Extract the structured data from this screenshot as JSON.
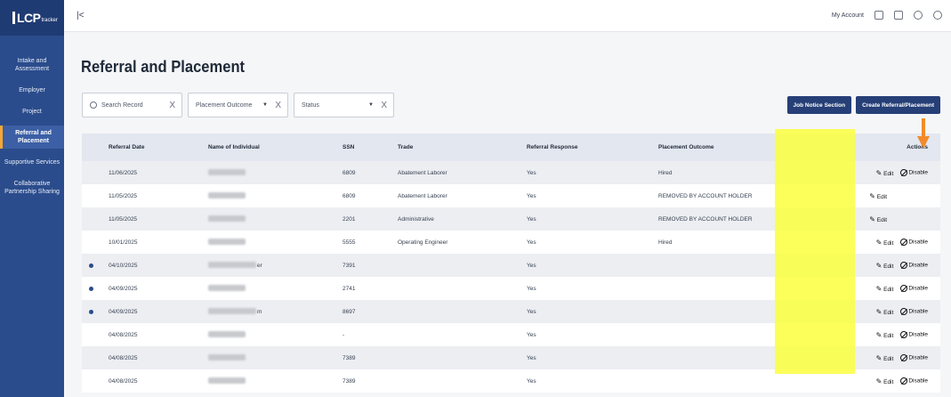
{
  "app": {
    "logo_text": "LCP",
    "logo_sub": "tracker",
    "collapse": "|<",
    "my_account": "My Account"
  },
  "sidebar": {
    "items": [
      {
        "label": "Intake and Assessment",
        "active": false
      },
      {
        "label": "Employer",
        "active": false
      },
      {
        "label": "Project",
        "active": false
      },
      {
        "label": "Referral and Placement",
        "active": true
      },
      {
        "label": "Supportive Services",
        "active": false
      },
      {
        "label": "Collaborative Partnership Sharing",
        "active": false
      }
    ]
  },
  "page": {
    "title": "Referral and Placement"
  },
  "filters": {
    "search_placeholder": "Search Record",
    "outcome_label": "Placement Outcome",
    "status_label": "Status",
    "clear": "X",
    "caret": "▼"
  },
  "buttons": {
    "job_notice": "Job Notice Section",
    "create": "Create Referral/Placement"
  },
  "table": {
    "columns": [
      "Referral Date",
      "Name of Individual",
      "SSN",
      "Trade",
      "Referral Response",
      "Placement Outcome",
      "Actions"
    ],
    "rows": [
      {
        "date": "11/06/2025",
        "ssn": "6809",
        "trade": "Abatement Laborer",
        "response": "Yes",
        "outcome": "Hired",
        "dot": false,
        "disable": true,
        "suffix": ""
      },
      {
        "date": "11/05/2025",
        "ssn": "6809",
        "trade": "Abatement Laborer",
        "response": "Yes",
        "outcome": "REMOVED BY ACCOUNT HOLDER",
        "dot": false,
        "disable": false,
        "suffix": ""
      },
      {
        "date": "11/05/2025",
        "ssn": "2201",
        "trade": "Administrative",
        "response": "Yes",
        "outcome": "REMOVED BY ACCOUNT HOLDER",
        "dot": false,
        "disable": false,
        "suffix": ""
      },
      {
        "date": "10/01/2025",
        "ssn": "5555",
        "trade": "Operating Engineer",
        "response": "Yes",
        "outcome": "Hired",
        "dot": false,
        "disable": true,
        "suffix": ""
      },
      {
        "date": "04/10/2025",
        "ssn": "7391",
        "trade": "",
        "response": "Yes",
        "outcome": "",
        "dot": true,
        "disable": true,
        "suffix": "er"
      },
      {
        "date": "04/09/2025",
        "ssn": "2741",
        "trade": "",
        "response": "Yes",
        "outcome": "",
        "dot": true,
        "disable": true,
        "suffix": ""
      },
      {
        "date": "04/09/2025",
        "ssn": "8697",
        "trade": "",
        "response": "Yes",
        "outcome": "",
        "dot": true,
        "disable": true,
        "suffix": "m"
      },
      {
        "date": "04/08/2025",
        "ssn": "-",
        "trade": "",
        "response": "Yes",
        "outcome": "",
        "dot": false,
        "disable": true,
        "suffix": ""
      },
      {
        "date": "04/08/2025",
        "ssn": "7389",
        "trade": "",
        "response": "Yes",
        "outcome": "",
        "dot": false,
        "disable": true,
        "suffix": ""
      },
      {
        "date": "04/08/2025",
        "ssn": "7389",
        "trade": "",
        "response": "Yes",
        "outcome": "",
        "dot": false,
        "disable": true,
        "suffix": ""
      }
    ],
    "edit_label": "Edit",
    "disable_label": "Disable"
  },
  "colors": {
    "sidebar": "#2b4c8c",
    "button": "#263f77",
    "highlight": "#fbff3d",
    "arrow": "#f38a2a"
  }
}
